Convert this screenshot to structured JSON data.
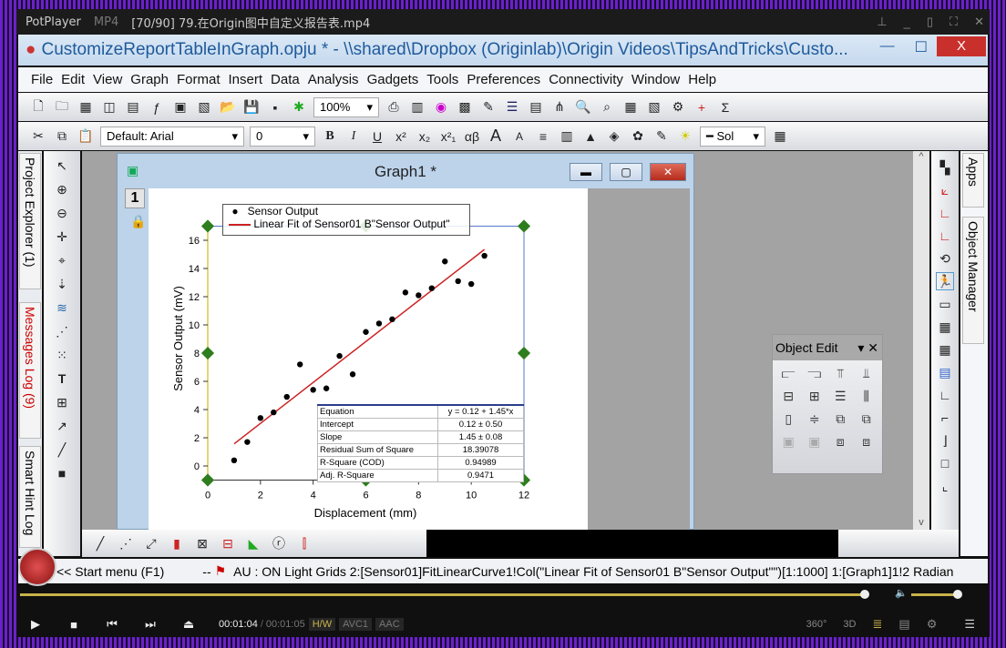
{
  "player": {
    "app": "PotPlayer",
    "format": "MP4",
    "file": "[70/90] 79.在Origin图中自定义报告表.mp4",
    "time_current": "00:01:04",
    "time_total": "00:01:05",
    "tags": [
      "H/W",
      "AVC1",
      "AAC"
    ],
    "progress_percent": 98,
    "volume_percent": 92,
    "right_icons": [
      "360°",
      "3D"
    ]
  },
  "origin": {
    "title": "CustomizeReportTableInGraph.opju * - \\\\shared\\Dropbox (Originlab)\\Origin Videos\\TipsAndTricks\\Custo...",
    "close": "X",
    "menu": [
      "File",
      "Edit",
      "View",
      "Graph",
      "Format",
      "Insert",
      "Data",
      "Analysis",
      "Gadgets",
      "Tools",
      "Preferences",
      "Connectivity",
      "Window",
      "Help"
    ],
    "zoom": "100%",
    "font": "Default: Arial",
    "font_size": "0",
    "line_style": "Sol",
    "format_buttons": [
      "B",
      "I",
      "U",
      "x²",
      "x₂",
      "x²₁",
      "αβ",
      "A",
      "A"
    ],
    "left_tabs": [
      "Project Explorer (1)",
      "Messages Log (9)",
      "Smart Hint Log"
    ],
    "right_tabs": [
      "Apps",
      "Object Manager"
    ],
    "status": {
      "start": "<< Start menu (F1)",
      "dash": "--",
      "info": "AU : ON Light Grids 2:[Sensor01]FitLinearCurve1!Col(\"Linear Fit of Sensor01 B\"Sensor Output\"\")[1:1000] 1:[Graph1]1!2 Radian"
    }
  },
  "graph_window": {
    "title": "Graph1 *",
    "layer": "1"
  },
  "object_edit": {
    "title": "Object Edit"
  },
  "accent": {
    "fit_line": "#cc2222",
    "handles": "#2e7d1e",
    "table_border": "#2a3d8a"
  },
  "chart_data": {
    "type": "scatter",
    "xlabel": "Displacement (mm)",
    "ylabel": "Sensor Output (mV)",
    "xlim": [
      0,
      12
    ],
    "ylim": [
      -1,
      17
    ],
    "xticks": [
      0,
      2,
      4,
      6,
      8,
      10,
      12
    ],
    "yticks": [
      0,
      2,
      4,
      6,
      8,
      10,
      12,
      14,
      16
    ],
    "legend": {
      "placement": "top",
      "entries": [
        "Sensor Output",
        "Linear Fit of Sensor01 B\"Sensor Output\""
      ]
    },
    "series": [
      {
        "name": "Sensor Output",
        "x": [
          1,
          1.5,
          2,
          2.5,
          3,
          3.5,
          4,
          4.5,
          5,
          5.5,
          6,
          6.5,
          7,
          7.5,
          8,
          8.5,
          9,
          9.5,
          10,
          10.5
        ],
        "y": [
          0.4,
          1.7,
          3.4,
          3.8,
          4.9,
          7.2,
          5.4,
          5.5,
          7.8,
          6.5,
          9.5,
          10.1,
          10.4,
          12.3,
          12.1,
          12.6,
          14.5,
          13.1,
          12.9,
          14.9
        ]
      },
      {
        "name": "Linear Fit of Sensor01 B\"Sensor Output\"",
        "type": "line",
        "intercept": 0.12,
        "slope": 1.45,
        "x_range": [
          1,
          10.5
        ]
      }
    ],
    "report_table": [
      [
        "Equation",
        "y = 0.12 + 1.45*x"
      ],
      [
        "Intercept",
        "0.12 ± 0.50"
      ],
      [
        "Slope",
        "1.45 ± 0.08"
      ],
      [
        "Residual Sum of Square",
        "18.39078"
      ],
      [
        "R-Square (COD)",
        "0.94989"
      ],
      [
        "Adj. R-Square",
        "0.9471"
      ]
    ]
  }
}
